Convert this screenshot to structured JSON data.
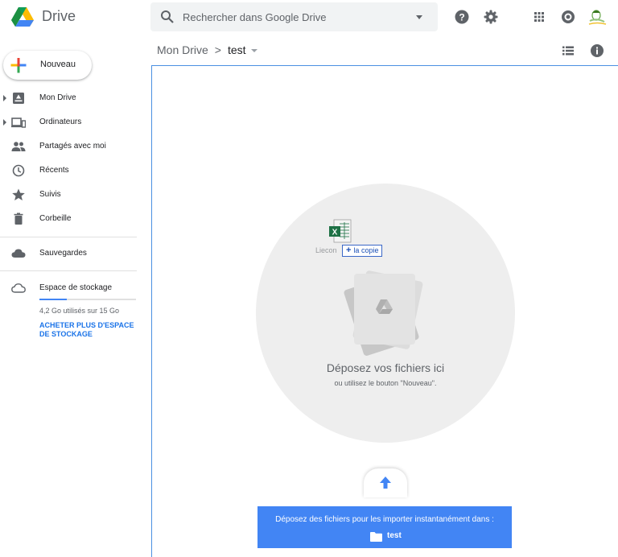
{
  "app": {
    "brand": "Drive"
  },
  "search": {
    "placeholder": "Rechercher dans Google Drive"
  },
  "sidebar": {
    "new_label": "Nouveau",
    "items": [
      {
        "label": "Mon Drive"
      },
      {
        "label": "Ordinateurs"
      },
      {
        "label": "Partagés avec moi"
      },
      {
        "label": "Récents"
      },
      {
        "label": "Suivis"
      },
      {
        "label": "Corbeille"
      },
      {
        "label": "Sauvegardes"
      },
      {
        "label": "Espace de stockage"
      }
    ],
    "storage": {
      "used_text": "4,2 Go utilisés sur 15 Go",
      "used_fraction": 0.28,
      "buy_label": "ACHETER PLUS D'ESPACE DE STOCKAGE"
    }
  },
  "breadcrumb": {
    "root": "Mon Drive",
    "separator": ">",
    "current": "test"
  },
  "dropzone": {
    "title": "Déposez vos fichiers ici",
    "subtitle": "ou utilisez le bouton \"Nouveau\".",
    "drag_file_name": "Liecon",
    "copy_tooltip": "la copie",
    "banner_message": "Déposez des fichiers pour les importer instantanément dans :",
    "banner_folder": "test"
  },
  "colors": {
    "accent": "#4285f4",
    "dropzone_border": "#4a90e2",
    "excel_green": "#1e7145"
  }
}
